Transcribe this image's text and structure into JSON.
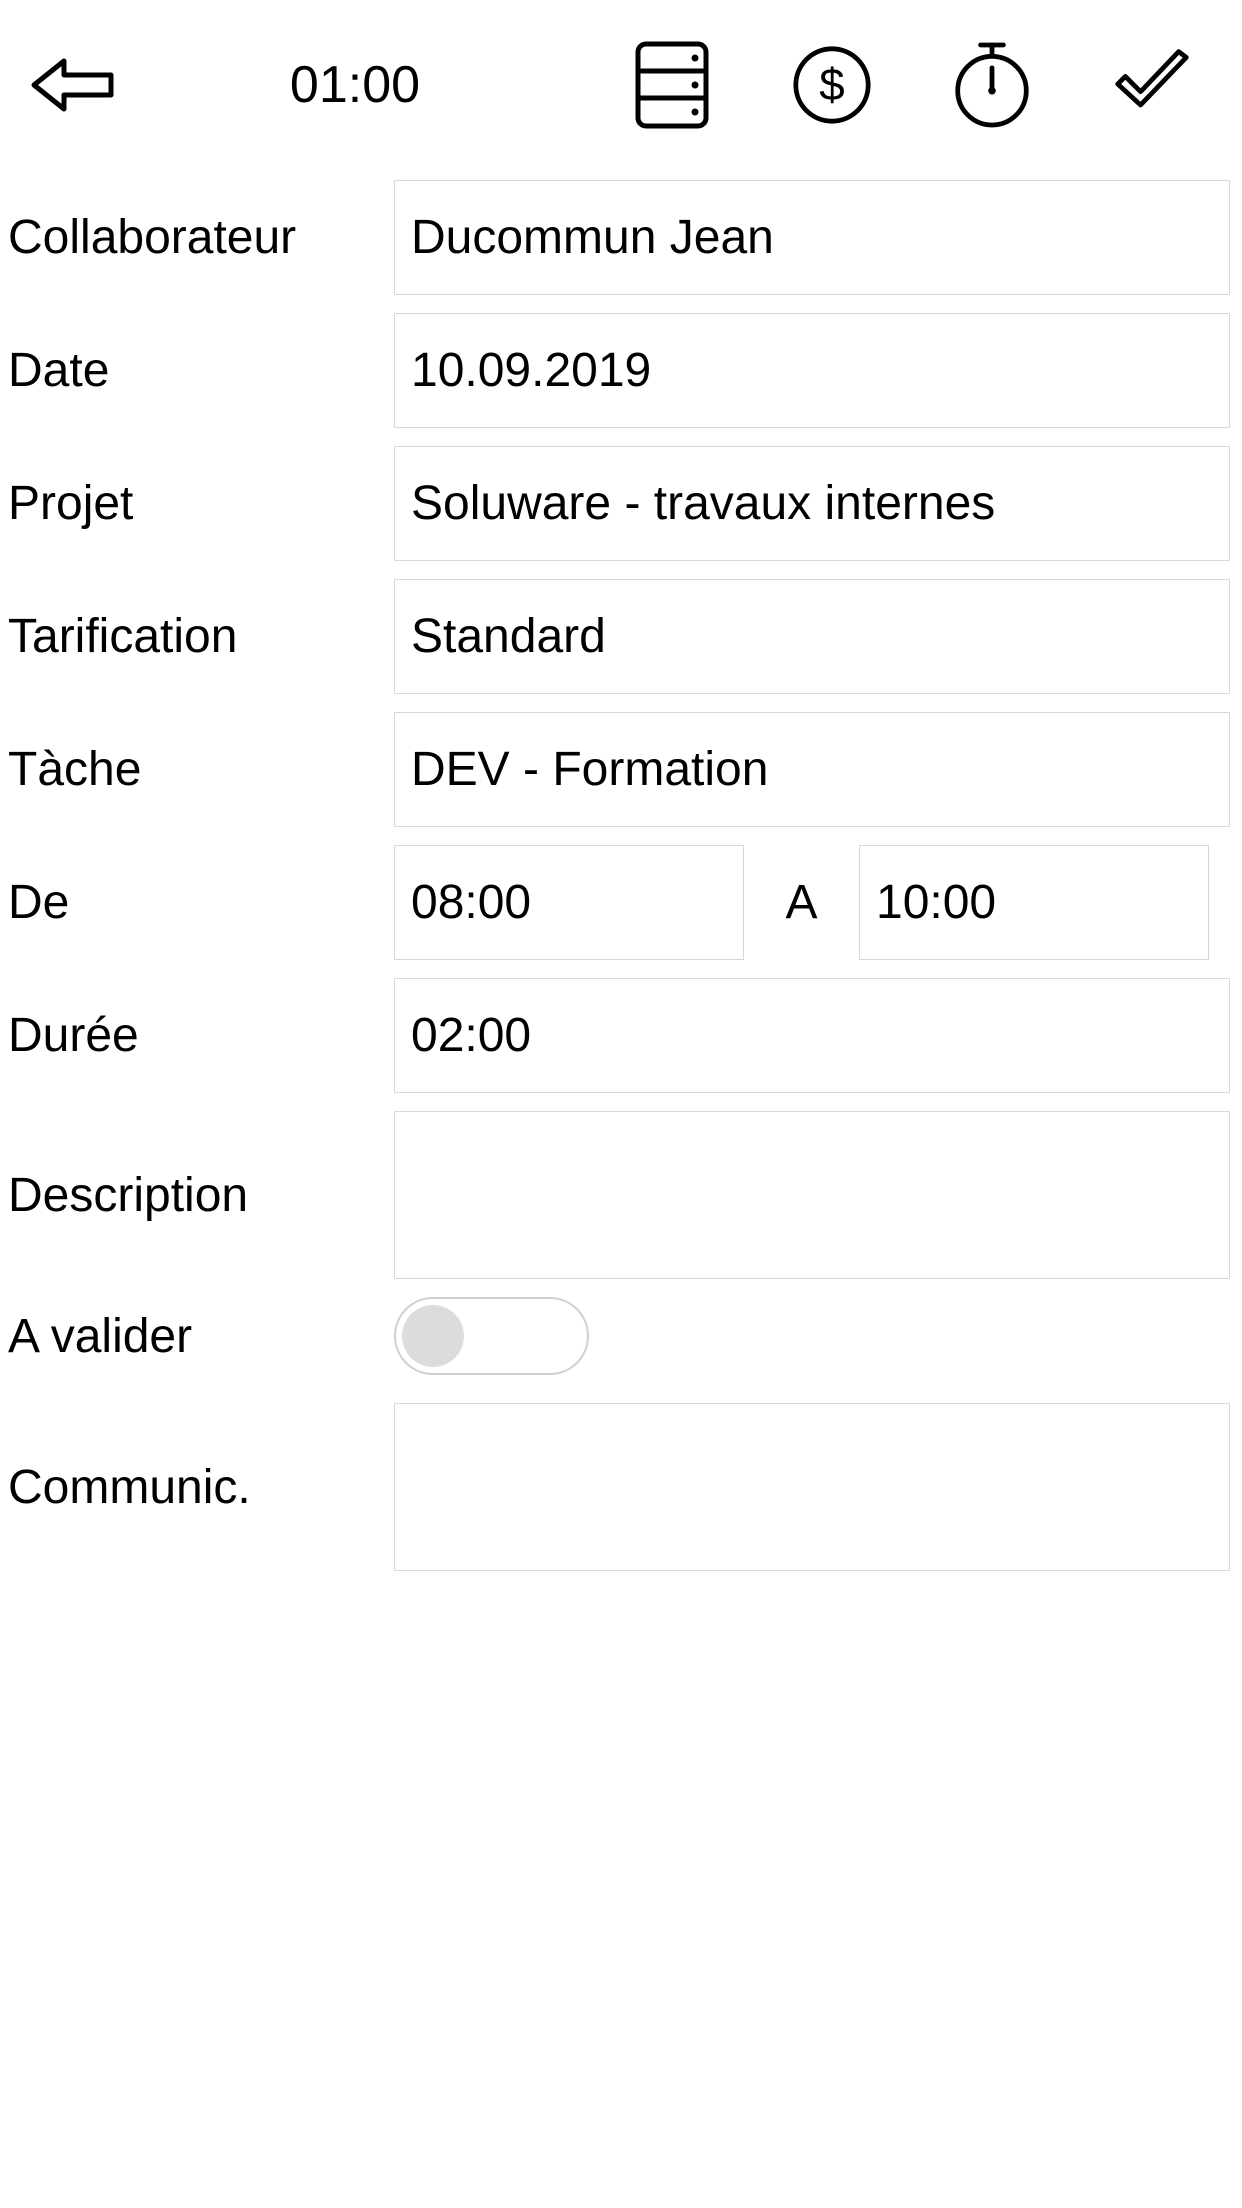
{
  "header": {
    "time": "01:00"
  },
  "form": {
    "collaborator": {
      "label": "Collaborateur",
      "value": "Ducommun Jean"
    },
    "date": {
      "label": "Date",
      "value": "10.09.2019"
    },
    "project": {
      "label": "Projet",
      "value": "Soluware - travaux internes"
    },
    "pricing": {
      "label": "Tarification",
      "value": "Standard"
    },
    "task": {
      "label": "Tàche",
      "value": "DEV - Formation"
    },
    "from": {
      "label": "De",
      "value": "08:00"
    },
    "to_sep": "A",
    "to": {
      "value": "10:00"
    },
    "duration": {
      "label": "Durée",
      "value": "02:00"
    },
    "description": {
      "label": "Description",
      "value": ""
    },
    "validate": {
      "label": "A valider",
      "on": false
    },
    "communic": {
      "label": "Communic.",
      "value": ""
    }
  }
}
